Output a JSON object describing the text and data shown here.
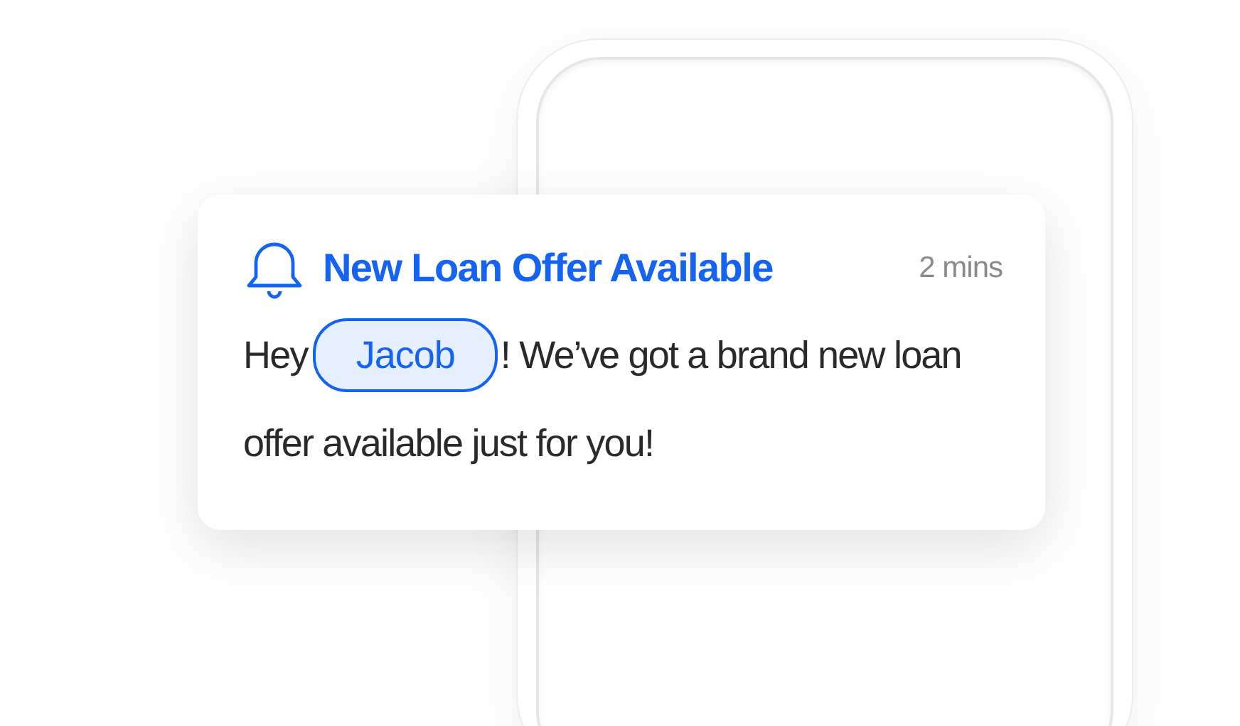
{
  "notification": {
    "title": "New Loan Offer Available",
    "time": "2 mins",
    "message": {
      "before": "Hey",
      "name": "Jacob",
      "after": "! We’ve got a brand new loan offer available just for you!"
    }
  }
}
